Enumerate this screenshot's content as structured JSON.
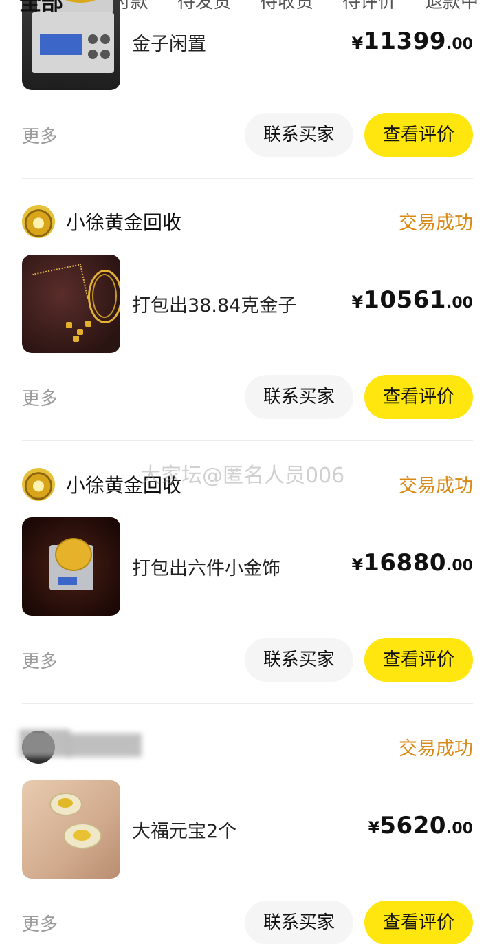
{
  "tabs": [
    "全部",
    "待付款",
    "待发货",
    "待收货",
    "待评价",
    "退款中"
  ],
  "active_tab": 0,
  "watermark": "大家坛@匿名人员006",
  "orders": [
    {
      "seller": "",
      "status": "",
      "title": "金子闲置",
      "price_symbol": "¥",
      "price_int": "11399",
      "price_dec": ".00",
      "more": "更多",
      "btn_contact": "联系买家",
      "btn_review": "查看评价"
    },
    {
      "seller": "小徐黄金回收",
      "status": "交易成功",
      "title": "打包出38.84克金子",
      "price_symbol": "¥",
      "price_int": "10561",
      "price_dec": ".00",
      "more": "更多",
      "btn_contact": "联系买家",
      "btn_review": "查看评价"
    },
    {
      "seller": "小徐黄金回收",
      "status": "交易成功",
      "title": "打包出六件小金饰",
      "price_symbol": "¥",
      "price_int": "16880",
      "price_dec": ".00",
      "more": "更多",
      "btn_contact": "联系买家",
      "btn_review": "查看评价"
    },
    {
      "seller": "",
      "status": "交易成功",
      "title": "大福元宝2个",
      "price_symbol": "¥",
      "price_int": "5620",
      "price_dec": ".00",
      "more": "更多",
      "btn_contact": "联系买家",
      "btn_review": "查看评价"
    }
  ]
}
